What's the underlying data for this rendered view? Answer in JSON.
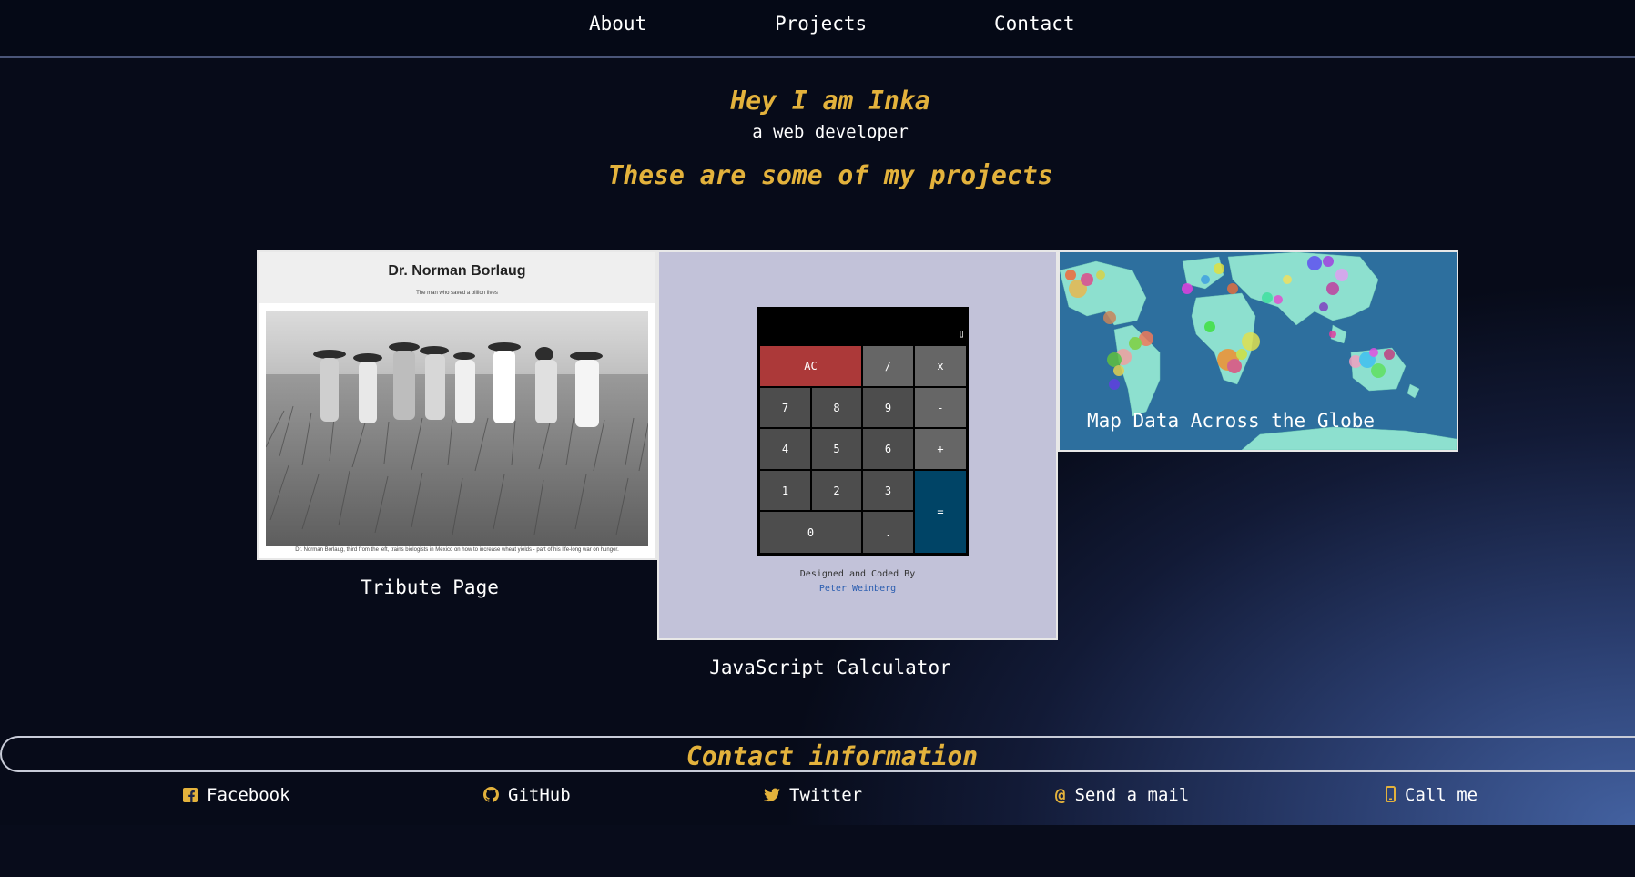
{
  "nav": {
    "about": "About",
    "projects": "Projects",
    "contact": "Contact"
  },
  "hero": {
    "title": "Hey I am Inka",
    "subtitle": "a web developer"
  },
  "projects": {
    "heading": "These are some of my projects",
    "items": [
      {
        "caption": "Tribute Page",
        "thumb_title": "Dr. Norman Borlaug",
        "thumb_tagline": "The man who saved a billion lives",
        "thumb_caption": "Dr. Norman Borlaug, third from the left, trains biologists in Mexico on how to increase wheat yields - part of his life-long war on hunger."
      },
      {
        "caption": "JavaScript Calculator",
        "credit_line": "Designed and Coded By",
        "credit_name": "Peter Weinberg",
        "keys": {
          "ac": "AC",
          "divide": "/",
          "multiply": "x",
          "seven": "7",
          "eight": "8",
          "nine": "9",
          "minus": "-",
          "four": "4",
          "five": "5",
          "six": "6",
          "plus": "+",
          "one": "1",
          "two": "2",
          "three": "3",
          "equals": "=",
          "zero": "0",
          "decimal": "."
        }
      },
      {
        "caption": "Map Data Across the Globe"
      }
    ]
  },
  "contact": {
    "heading": "Contact information",
    "links": {
      "facebook": "Facebook",
      "github": "GitHub",
      "twitter": "Twitter",
      "mail": "Send a mail",
      "call": "Call me"
    }
  },
  "colors": {
    "accent": "#e3b23c",
    "nav_bg": "#050916",
    "calc_red": "#ac3939",
    "calc_blue": "#004466",
    "calc_gray": "#666666",
    "calc_dark": "#4d4d4d",
    "map_ocean": "#2d6f9e",
    "map_land": "#8de0cf"
  }
}
